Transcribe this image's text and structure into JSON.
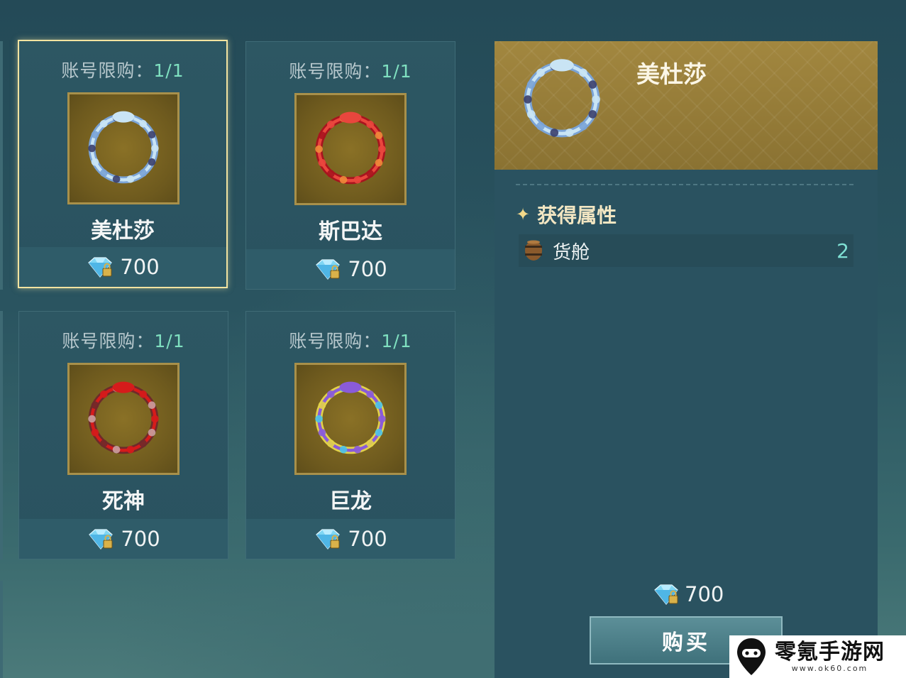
{
  "shop": {
    "items": [
      {
        "limit_label": "账号限购：",
        "limit_count": "1/1",
        "name": "美杜莎",
        "price": "700",
        "ring_colors": [
          "#c9e4f4",
          "#3b3f6d",
          "#7aa3d6"
        ]
      },
      {
        "limit_label": "账号限购：",
        "limit_count": "1/1",
        "name": "斯巴达",
        "price": "700",
        "ring_colors": [
          "#e9463d",
          "#f08a3a",
          "#a8141e"
        ]
      },
      {
        "limit_label": "账号限购：",
        "limit_count": "1/1",
        "name": "死神",
        "price": "700",
        "ring_colors": [
          "#d61b1b",
          "#c9a1a1",
          "#6f2a2a"
        ]
      },
      {
        "limit_label": "账号限购：",
        "limit_count": "1/1",
        "name": "巨龙",
        "price": "700",
        "ring_colors": [
          "#8a5bd9",
          "#4bc3e8",
          "#e2d24a"
        ]
      }
    ]
  },
  "detail": {
    "title": "美杜莎",
    "attr_title": "获得属性",
    "attributes": [
      {
        "label": "货舱",
        "value": "2",
        "icon": "barrel-icon"
      }
    ],
    "price": "700",
    "buy_label": "购买"
  },
  "watermark": {
    "text": "零氪手游网",
    "url": "www.ok60.com"
  },
  "colors": {
    "accent_gold": "#a2873f",
    "limit_count": "#7fe0c0",
    "selected_border": "#f2e3a0"
  }
}
